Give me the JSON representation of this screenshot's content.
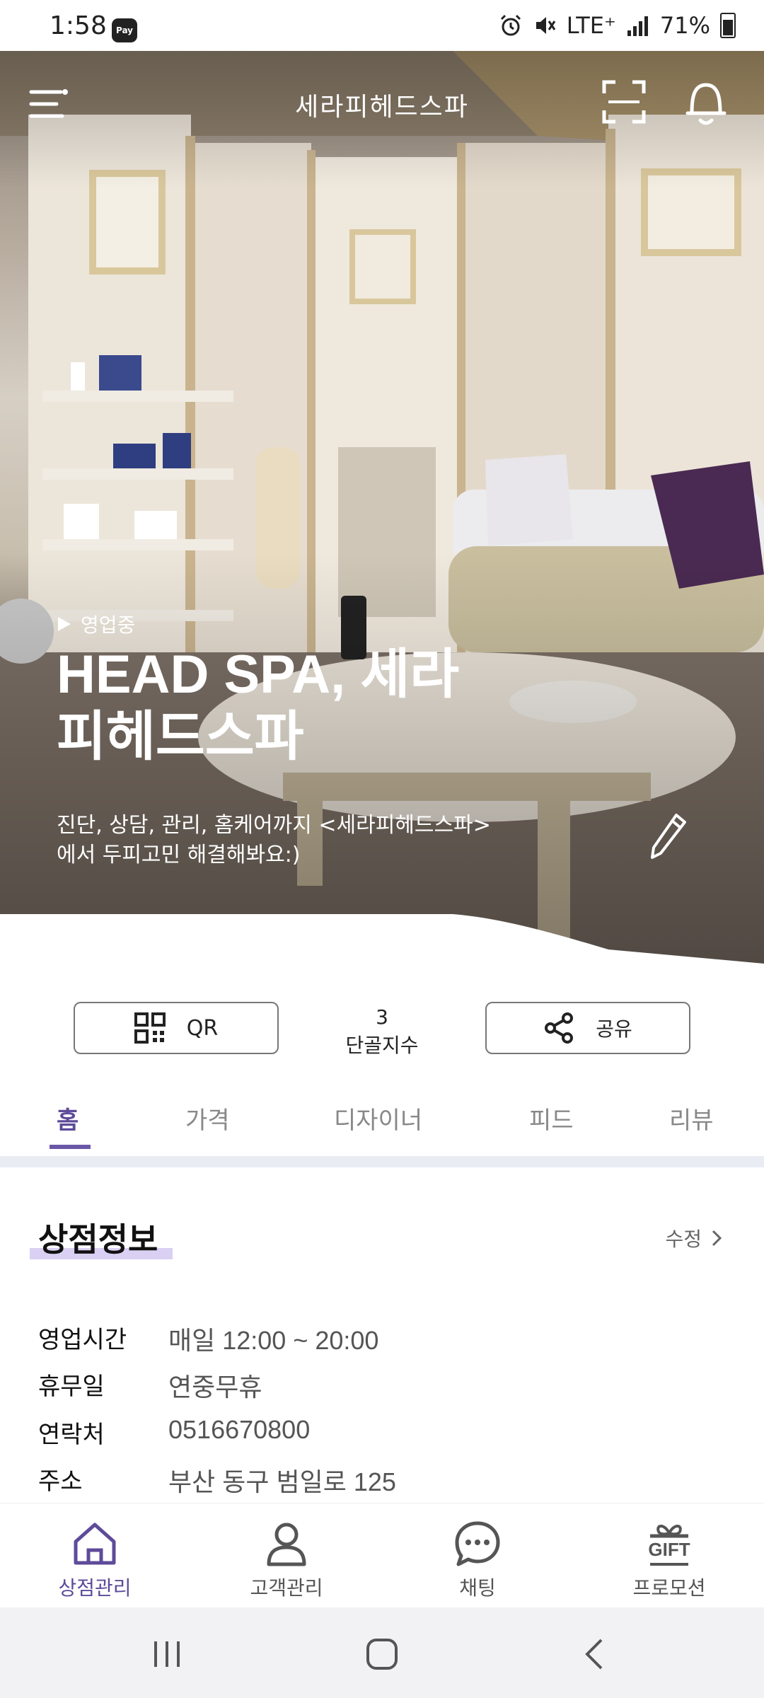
{
  "status_bar": {
    "time": "1:58",
    "pay_badge": "Pay",
    "network": "LTE⁺",
    "battery": "71%"
  },
  "header": {
    "title": "세라피헤드스파"
  },
  "hero": {
    "open_status": "영업중",
    "shop_name": "HEAD SPA, 세라피헤드스파",
    "description": "진단, 상담, 관리, 홈케어까지 <세라피헤드스파> 에서 두피고민 해결해봐요:)"
  },
  "stats": {
    "qr_label": "QR",
    "regulars_count": "3",
    "regulars_label": "단골지수",
    "share_label": "공유"
  },
  "tabs": [
    {
      "label": "홈",
      "active": true
    },
    {
      "label": "가격",
      "active": false
    },
    {
      "label": "디자이너",
      "active": false
    },
    {
      "label": "피드",
      "active": false
    },
    {
      "label": "리뷰",
      "active": false
    }
  ],
  "store_info": {
    "title": "상점정보",
    "edit_label": "수정",
    "rows": [
      {
        "label": "영업시간",
        "value": "매일 12:00 ~ 20:00"
      },
      {
        "label": "휴무일",
        "value": "연중무휴"
      },
      {
        "label": "연락처",
        "value": "0516670800"
      },
      {
        "label": "주소",
        "value": "부산 동구 범일로 125"
      }
    ]
  },
  "bottom_nav": [
    {
      "label": "상점관리",
      "icon": "home-icon",
      "active": true
    },
    {
      "label": "고객관리",
      "icon": "person-icon",
      "active": false
    },
    {
      "label": "채팅",
      "icon": "chat-icon",
      "active": false
    },
    {
      "label": "프로모션",
      "icon": "gift-icon",
      "gift_text": "GIFT",
      "active": false
    }
  ],
  "colors": {
    "accent": "#5e4b99",
    "highlight": "#d9d0f3",
    "divider": "#e9edf3"
  }
}
